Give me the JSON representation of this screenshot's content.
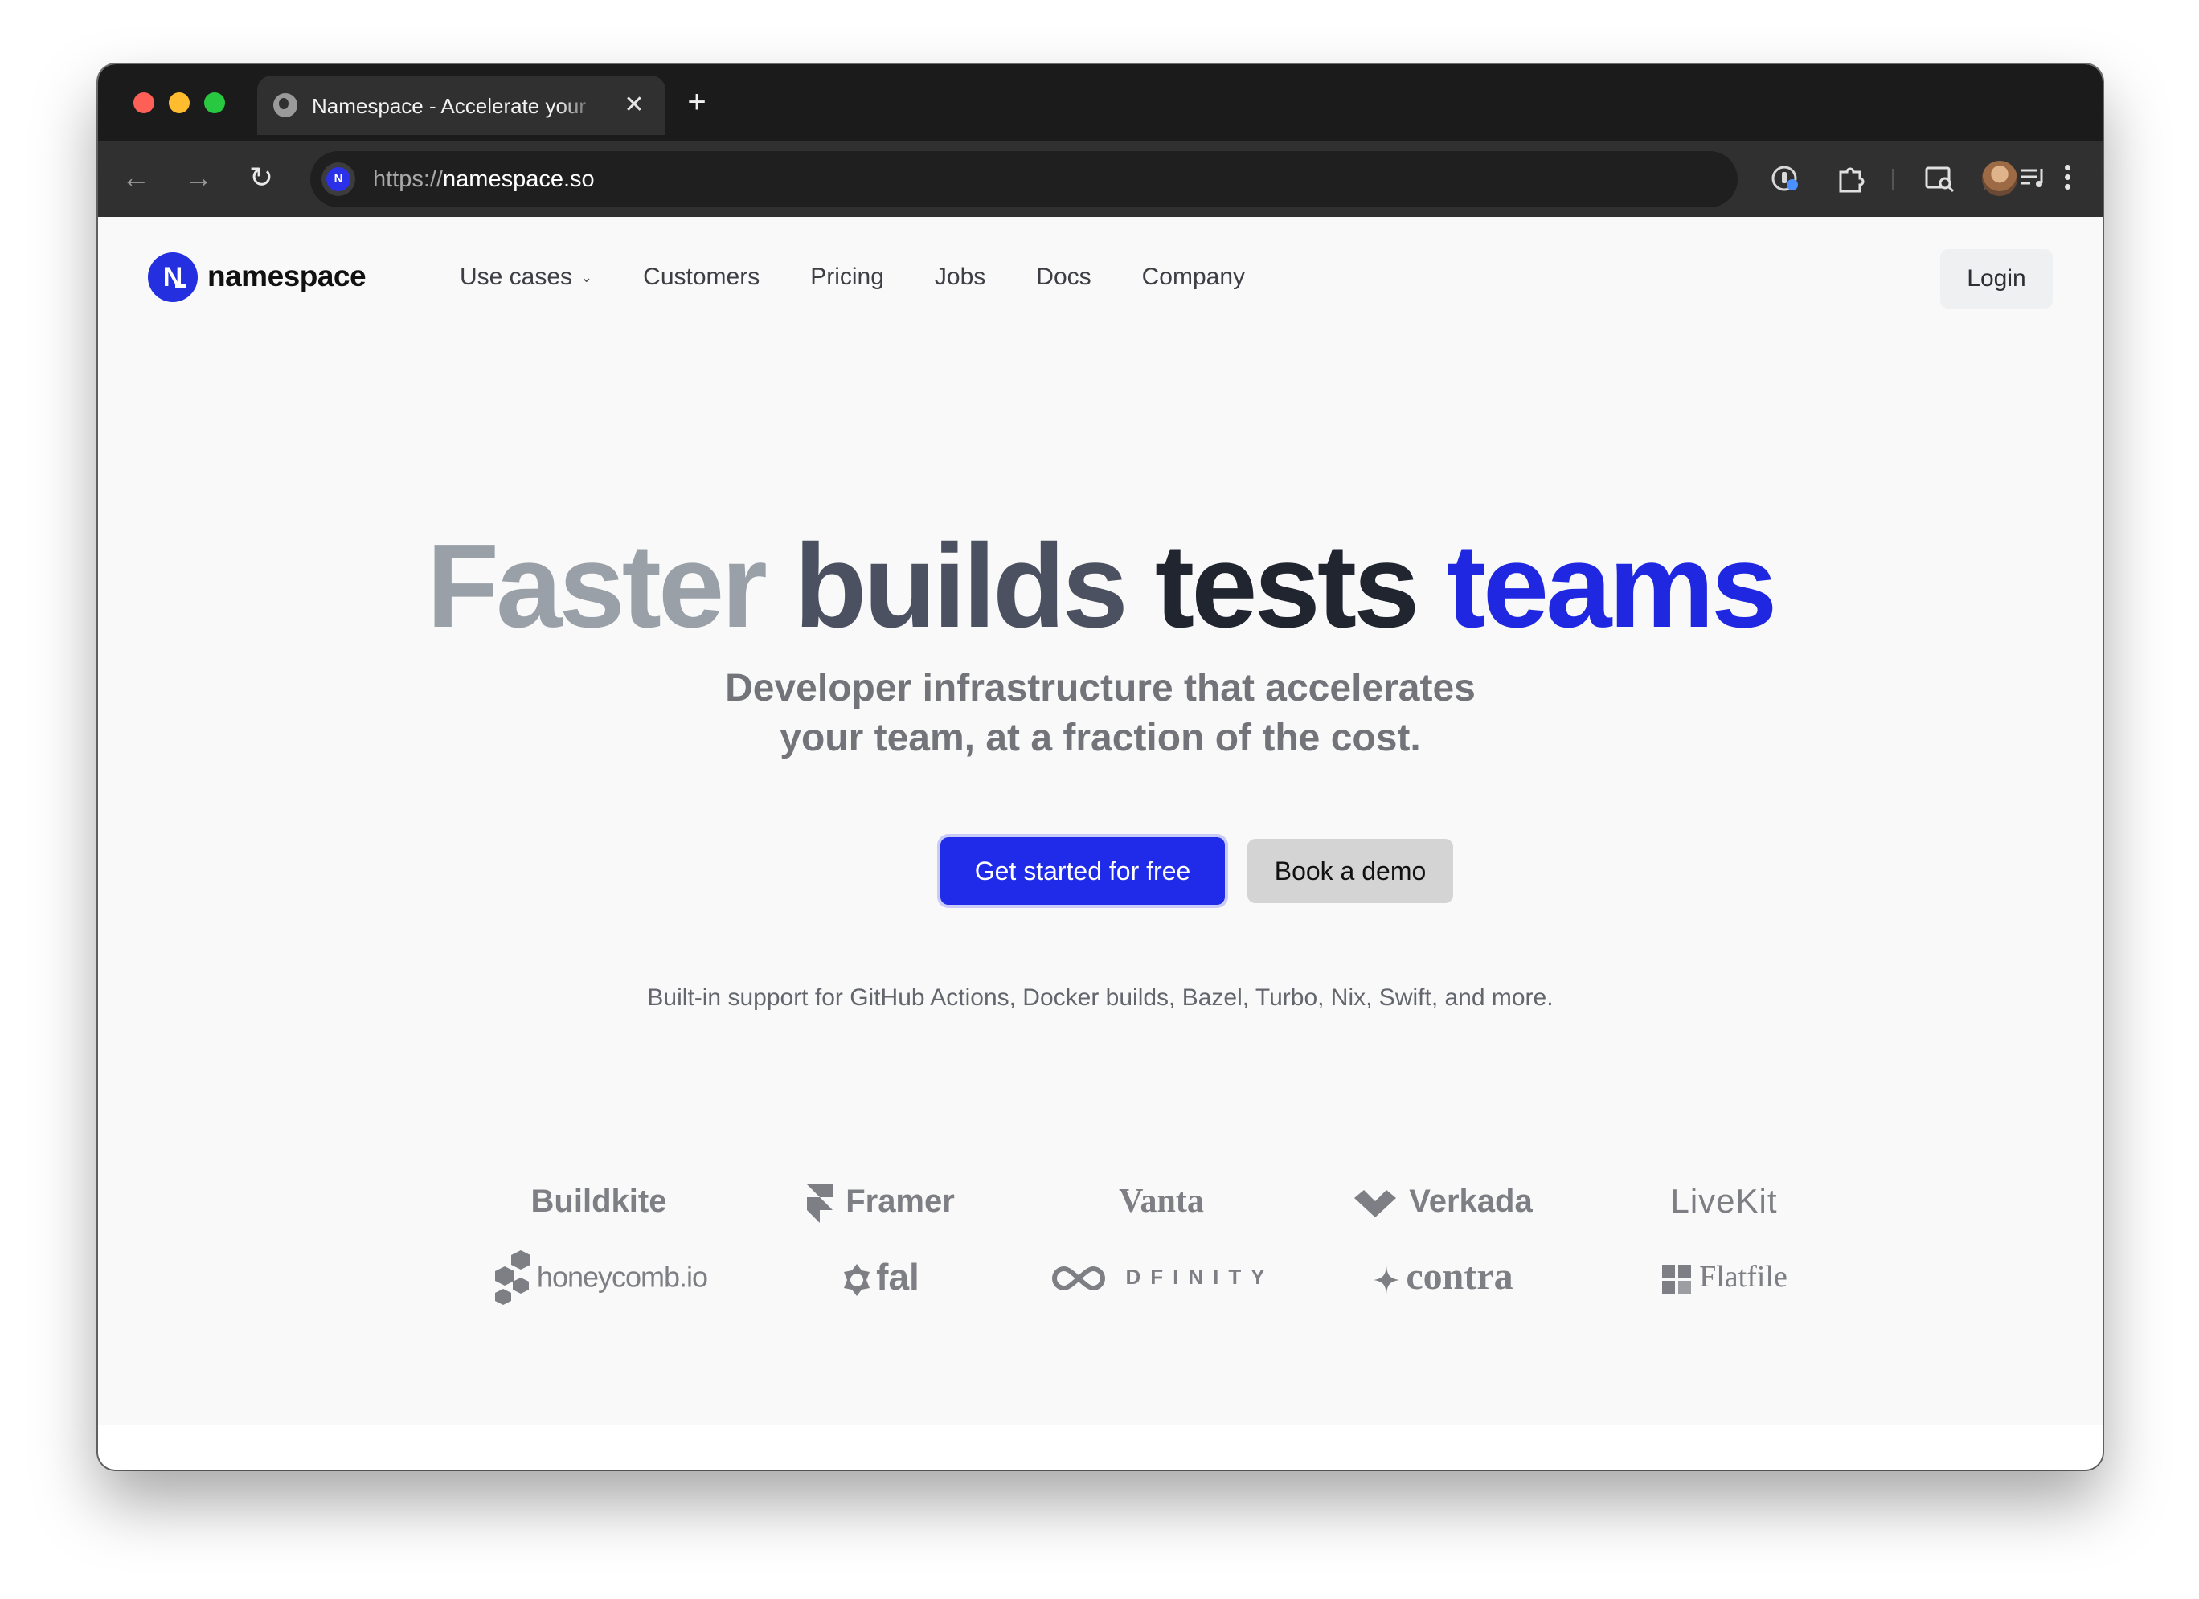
{
  "browser": {
    "tab_title": "Namespace - Accelerate your",
    "tab_close": "✕",
    "new_tab": "+",
    "url_scheme": "https://",
    "url_host": "namespace.so",
    "site_badge": "N"
  },
  "site": {
    "logo_mark": "N",
    "logo_text": "namespace",
    "nav": [
      {
        "label": "Use cases",
        "has_dropdown": true
      },
      {
        "label": "Customers"
      },
      {
        "label": "Pricing"
      },
      {
        "label": "Jobs"
      },
      {
        "label": "Docs"
      },
      {
        "label": "Company"
      }
    ],
    "login": "Login"
  },
  "hero": {
    "title_words": [
      "Faster",
      "builds",
      "tests",
      "teams"
    ],
    "subtitle_line1": "Developer infrastructure that accelerates",
    "subtitle_line2": "your team, at a fraction of the cost.",
    "cta_primary": "Get started for free",
    "cta_secondary": "Book a demo",
    "support_text": "Built-in support for GitHub Actions, Docker builds, Bazel, Turbo, Nix, Swift, and more."
  },
  "customer_logos": [
    [
      "Buildkite",
      "Framer",
      "Vanta",
      "Verkada",
      "LiveKit"
    ],
    [
      "honeycomb.io",
      "fal",
      "DFINITY",
      "contra",
      "Flatfile"
    ]
  ],
  "colors": {
    "brand_blue": "#1f27e0",
    "primary_button": "#1f2be8",
    "title_gray_1": "#9aa0a8",
    "title_gray_2": "#4b5160",
    "title_dark": "#212530"
  }
}
